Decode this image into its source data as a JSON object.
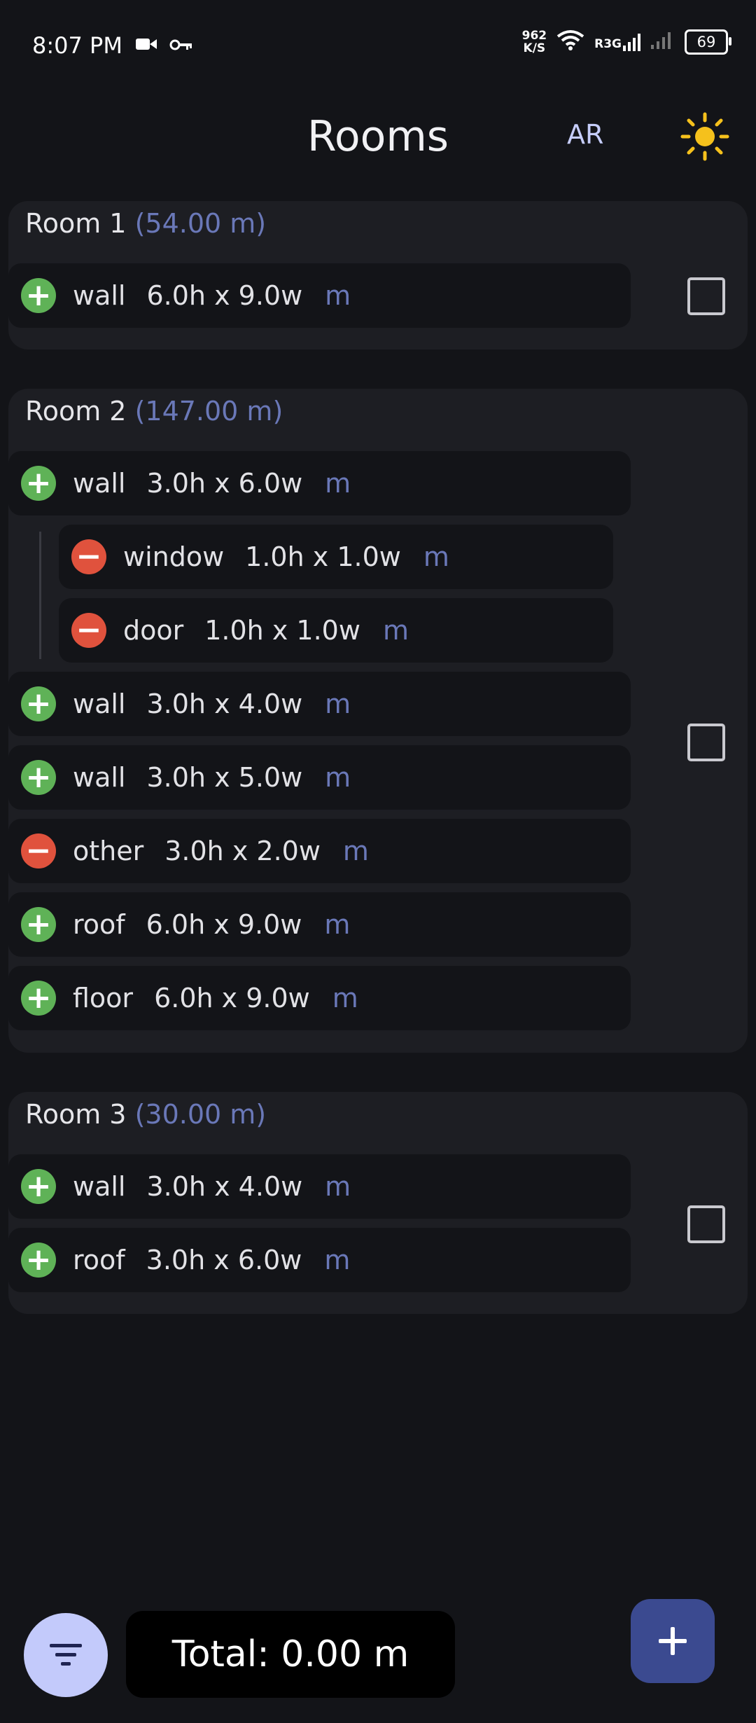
{
  "status_bar": {
    "time": "8:07 PM",
    "net_speed_value": "962",
    "net_speed_unit": "K/S",
    "carrier": "R3G",
    "battery": "69"
  },
  "app_bar": {
    "title": "Rooms",
    "ar_label": "AR",
    "theme_icon": "sun-icon"
  },
  "rooms": [
    {
      "name": "Room 1",
      "area": "(54.00 m)",
      "items": [
        {
          "type": "wall",
          "dims": "6.0h x 9.0w",
          "unit": "m",
          "sign": "plus"
        }
      ]
    },
    {
      "name": "Room 2",
      "area": "(147.00 m)",
      "items": [
        {
          "type": "wall",
          "dims": "3.0h x 6.0w",
          "unit": "m",
          "sign": "plus"
        },
        {
          "type": "window",
          "dims": "1.0h x 1.0w",
          "unit": "m",
          "sign": "minus"
        },
        {
          "type": "door",
          "dims": "1.0h x 1.0w",
          "unit": "m",
          "sign": "minus"
        },
        {
          "type": "wall",
          "dims": "3.0h x 4.0w",
          "unit": "m",
          "sign": "plus"
        },
        {
          "type": "wall",
          "dims": "3.0h x 5.0w",
          "unit": "m",
          "sign": "plus"
        },
        {
          "type": "other",
          "dims": "3.0h x 2.0w",
          "unit": "m",
          "sign": "minus"
        },
        {
          "type": "roof",
          "dims": "6.0h x 9.0w",
          "unit": "m",
          "sign": "plus"
        },
        {
          "type": "floor",
          "dims": "6.0h x 9.0w",
          "unit": "m",
          "sign": "plus"
        }
      ]
    },
    {
      "name": "Room 3",
      "area": "(30.00 m)",
      "items": [
        {
          "type": "wall",
          "dims": "3.0h x 4.0w",
          "unit": "m",
          "sign": "plus"
        },
        {
          "type": "roof",
          "dims": "3.0h x 6.0w",
          "unit": "m",
          "sign": "plus"
        }
      ]
    }
  ],
  "footer": {
    "total_label": "Total: 0.00 m"
  },
  "colors": {
    "background": "#131418",
    "card": "#1d1e23",
    "accent_text": "#6a78b8",
    "plus": "#5fb257",
    "minus": "#e0523d",
    "fab": "#3b4a90",
    "filter_fab": "#c3cafb",
    "sun": "#f5c11c"
  }
}
